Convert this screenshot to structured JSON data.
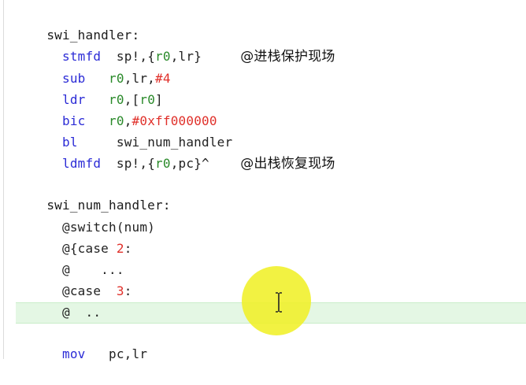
{
  "code_lines": [
    {
      "label": "swi_handler:"
    },
    {
      "mnemonic": "stmfd",
      "args_a": "sp!,{",
      "reg1": "r0",
      "args_b": ",lr}",
      "comment": "@进栈保护现场"
    },
    {
      "mnemonic": "sub",
      "reg1": "r0",
      "args_a": ",lr,",
      "num": "#4"
    },
    {
      "mnemonic": "ldr",
      "reg1": "r0",
      "args_a": ",[",
      "reg2": "r0",
      "args_b": "]"
    },
    {
      "mnemonic": "bic",
      "reg1": "r0",
      "args_a": ",",
      "num": "#0xff000000"
    },
    {
      "mnemonic": "bl",
      "target": "swi_num_handler"
    },
    {
      "mnemonic": "ldmfd",
      "args_a": "sp!,{",
      "reg1": "r0",
      "args_b": ",pc}^",
      "comment": "@出栈恢复现场"
    },
    {
      "label": "swi_num_handler:"
    },
    {
      "comment_line": "@switch(num)"
    },
    {
      "comment_a": "@{case ",
      "num": "2",
      "comment_b": ":"
    },
    {
      "comment_line": "@    ..."
    },
    {
      "comment_a": "@case  ",
      "num": "3",
      "comment_b": ":"
    },
    {
      "comment_line": "@  .."
    },
    {
      "mnemonic": "mov",
      "args_a": "pc,lr"
    }
  ],
  "colors": {
    "keyword": "#2b2bd6",
    "register": "#2a8a2a",
    "number": "#e0302a",
    "current_line": "#e4f7e4",
    "cursor_spot": "#f0f028"
  },
  "icons": {
    "cursor": "i-beam-cursor-icon"
  }
}
